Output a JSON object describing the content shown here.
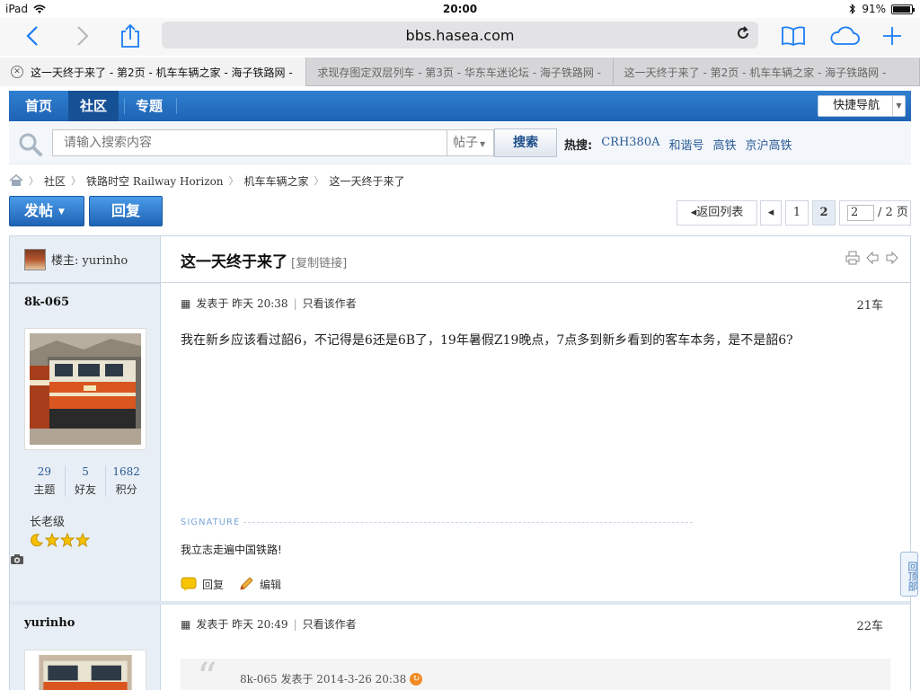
{
  "status": {
    "device": "iPad",
    "time": "20:00",
    "battery": "91%"
  },
  "browser": {
    "url": "bbs.hasea.com"
  },
  "tabs": [
    {
      "title": "这一天终于来了 - 第2页 - 机车车辆之家 - 海子铁路网 -"
    },
    {
      "title": "求现存图定双层列车 - 第3页 - 华东车迷论坛 - 海子铁路网 -"
    },
    {
      "title": "这一天终于来了 - 第2页 - 机车车辆之家 - 海子铁路网 -"
    }
  ],
  "nav": {
    "items": [
      "首页",
      "社区",
      "专题"
    ],
    "quick_nav": "快捷导航"
  },
  "search": {
    "placeholder": "请输入搜索内容",
    "type": "帖子",
    "button": "搜索",
    "hot_label": "热搜:",
    "hot_links": [
      "CRH380A",
      "和谐号",
      "高铁",
      "京沪高铁"
    ]
  },
  "breadcrumb": [
    "社区",
    "铁路时空 Railway Horizon",
    "机车车辆之家",
    "这一天终于来了"
  ],
  "actions": {
    "post": "发帖",
    "reply": "回复"
  },
  "pagination": {
    "back": "返回列表",
    "pages": [
      "1",
      "2"
    ],
    "current": "2",
    "input": "2",
    "total": "/ 2 页"
  },
  "thread": {
    "owner_label": "楼主: yurinho",
    "title": "这一天终于来了",
    "copy_link": "[复制链接]"
  },
  "posts": [
    {
      "author": "8k-065",
      "stats": [
        {
          "num": "29",
          "label": "主题"
        },
        {
          "num": "5",
          "label": "好友"
        },
        {
          "num": "1682",
          "label": "积分"
        }
      ],
      "rank": "长老级",
      "meta_time": "发表于 昨天 20:38",
      "meta_only": "只看该作者",
      "floor": "21车",
      "body": "我在新乡应该看过韶6，不记得是6还是6B了，19年暑假Z19晚点，7点多到新乡看到的客车本务，是不是韶6?",
      "signature_label": "SIGNATURE",
      "signature": "我立志走遍中国铁路!",
      "reply": "回复",
      "edit": "编辑"
    },
    {
      "author": "yurinho",
      "meta_time": "发表于 昨天 20:49",
      "meta_only": "只看该作者",
      "floor": "22车",
      "quote": "8k-065 发表于 2014-3-26 20:38"
    }
  ],
  "back_to_top": "回顶部"
}
